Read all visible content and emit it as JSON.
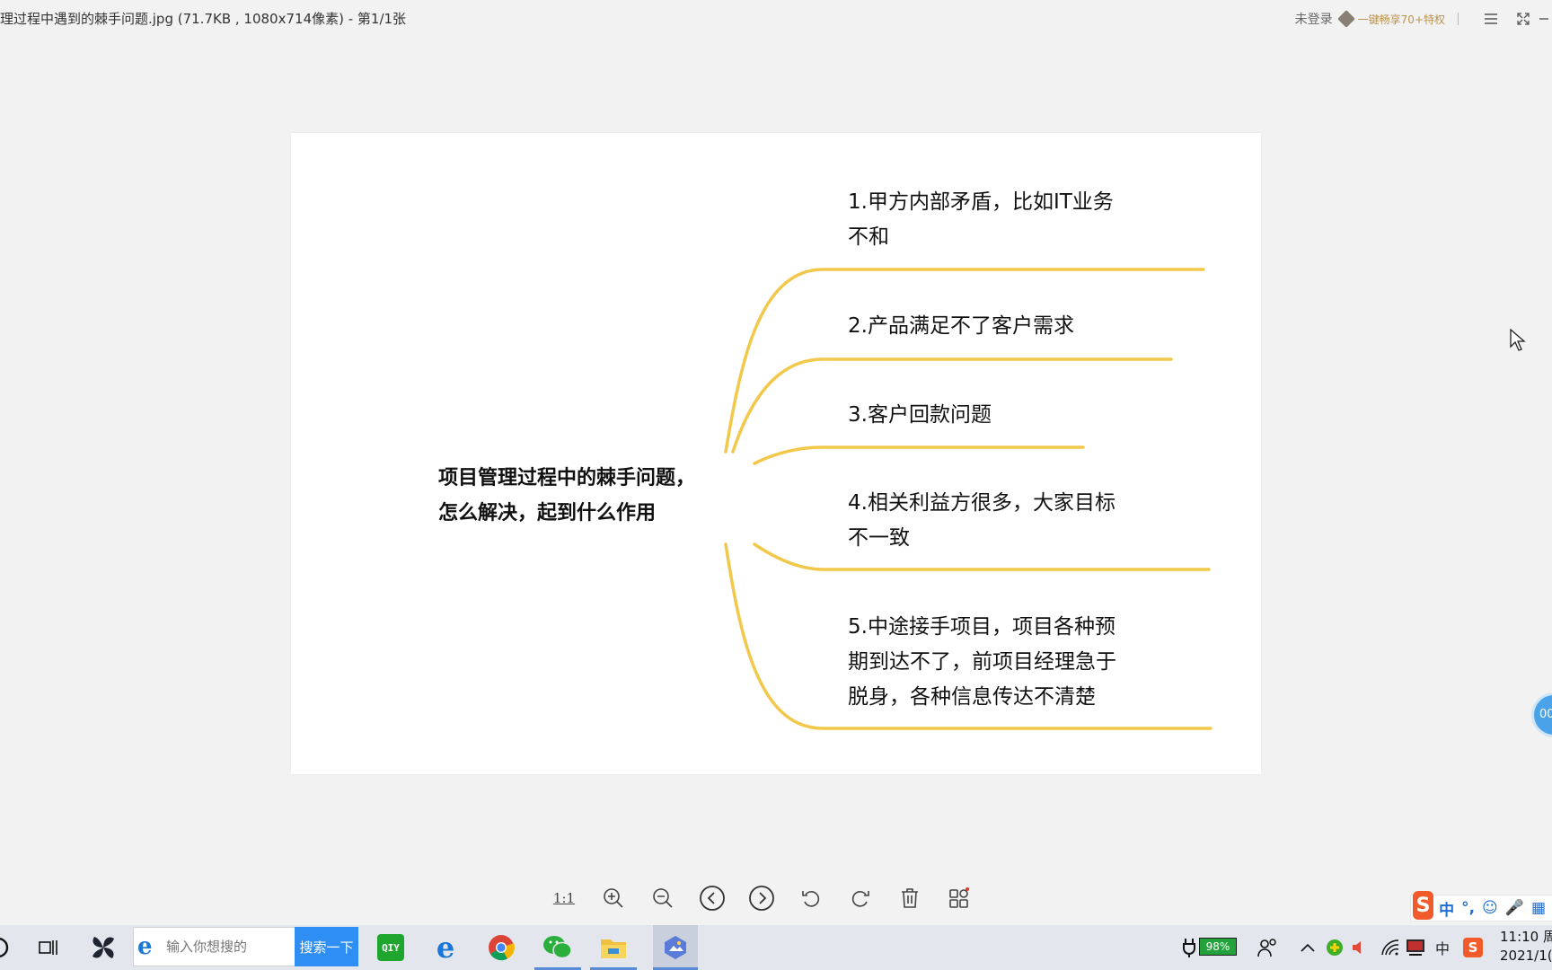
{
  "window": {
    "title": "理过程中遇到的棘手问题.jpg (71.7KB , 1080x714像素) - 第1/1张",
    "login_text": "未登录",
    "promo_text": "一键畅享70+特权"
  },
  "mindmap": {
    "root": [
      "项目管理过程中的棘手问题，",
      "怎么解决，起到什么作用"
    ],
    "branches": [
      {
        "lines": [
          "1.甲方内部矛盾，比如IT业务",
          "不和"
        ]
      },
      {
        "lines": [
          "2.产品满足不了客户需求"
        ]
      },
      {
        "lines": [
          "3.客户回款问题"
        ]
      },
      {
        "lines": [
          "4.相关利益方很多，大家目标",
          "不一致"
        ]
      },
      {
        "lines": [
          "5.中途接手项目，项目各种预",
          "期到达不了，前项目经理急于",
          "脱身，各种信息传达不清楚"
        ]
      }
    ],
    "accent_color": "#f2c84b"
  },
  "toolbar": {
    "ratio_label": "1:1",
    "icons": [
      "zoom-in-icon",
      "zoom-out-icon",
      "previous-icon",
      "next-icon",
      "rotate-left-icon",
      "rotate-right-icon",
      "delete-icon",
      "grid-view-icon"
    ]
  },
  "ime": {
    "lang": "中",
    "punct": "°,"
  },
  "float_button": {
    "label": "00"
  },
  "taskbar": {
    "search_placeholder": "输入你想搜的",
    "search_button": "搜索一下",
    "battery": "98%",
    "tray_lang": "中",
    "time": "11:10 周",
    "date": "2021/1("
  }
}
